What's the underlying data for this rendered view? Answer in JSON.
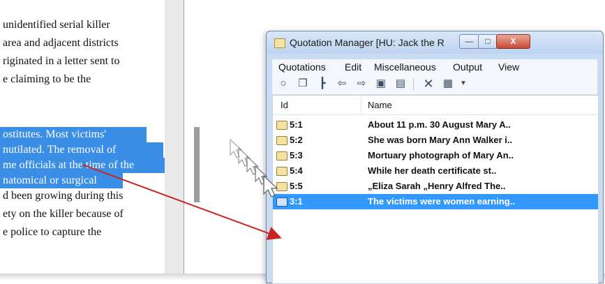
{
  "document": {
    "lines": [
      {
        "text": "unidentified serial killer",
        "selected": false
      },
      {
        "text": "area and adjacent districts",
        "selected": false
      },
      {
        "text": "riginated in a letter sent to",
        "selected": false
      },
      {
        "text": "e claiming to be the",
        "selected": false
      },
      {
        "text": "ostitutes. Most victims'",
        "selected": true
      },
      {
        "text": "nutilated. The removal of",
        "selected": true
      },
      {
        "text": "me officials at the time of the",
        "selected": true
      },
      {
        "text": "natomical or surgical",
        "selected": true
      },
      {
        "text": "d been growing during this",
        "selected": false
      },
      {
        "text": "ety on the killer because of",
        "selected": false
      },
      {
        "text": "e police to capture the",
        "selected": false
      }
    ]
  },
  "window": {
    "title": "Quotation Manager [HU: Jack the Ripper_s...",
    "title_icon": "document-icon",
    "controls": {
      "minimize": "—",
      "maximize": "□",
      "close": "X"
    }
  },
  "menubar": {
    "items": [
      "Quotations",
      "Edit",
      "Miscellaneous",
      "Output",
      "View"
    ]
  },
  "toolbar": {
    "icons": [
      "comment-icon",
      "copy-icon",
      "tree-icon",
      "arrow-left-icon",
      "arrow-right-icon",
      "link-icon",
      "unlink-icon",
      "delete-icon",
      "view-options-icon"
    ]
  },
  "list": {
    "columns": {
      "id": "Id",
      "name": "Name"
    },
    "rows": [
      {
        "id": "5:1",
        "name": "About 11 p.m. 30 August Mary A..",
        "selected": false
      },
      {
        "id": "5:2",
        "name": "She was born Mary Ann Walker i..",
        "selected": false
      },
      {
        "id": "5:3",
        "name": "Mortuary photograph of Mary An..",
        "selected": false
      },
      {
        "id": "5:4",
        "name": "While her death certificate st..",
        "selected": false
      },
      {
        "id": "5:5",
        "name": "„Eliza Sarah „Henry Alfred The..",
        "selected": false
      },
      {
        "id": "3:1",
        "name": "The victims were women earning..",
        "selected": true
      }
    ]
  },
  "colors": {
    "selection": "#3399ff",
    "drag_arrow": "#cc2222"
  }
}
